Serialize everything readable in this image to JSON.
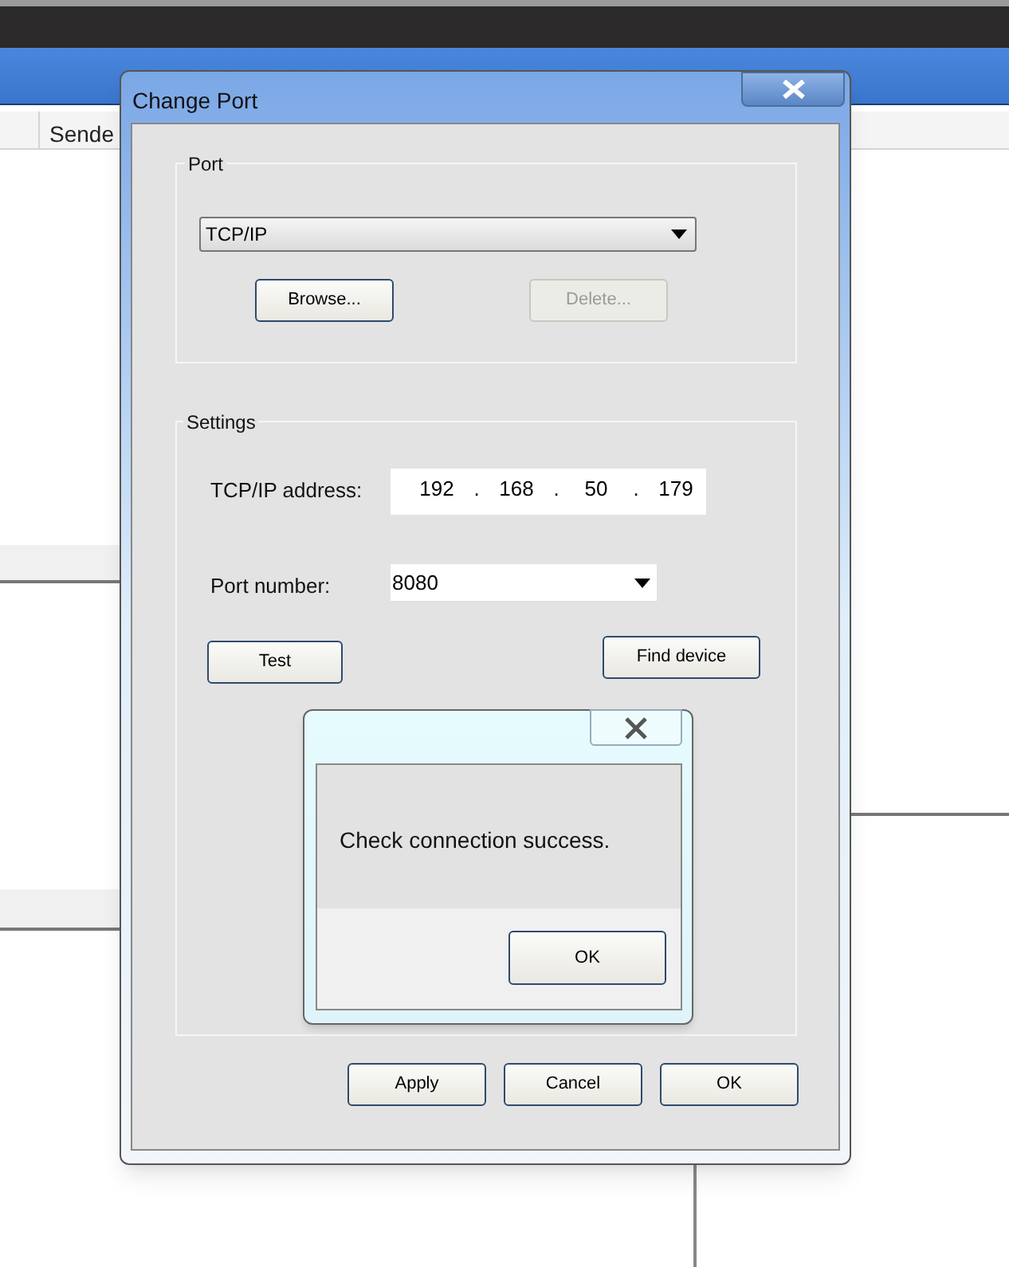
{
  "background_window": {
    "column_header": "Sende"
  },
  "dialog": {
    "title": "Change Port",
    "port_group": {
      "label": "Port",
      "port_type": "TCP/IP",
      "buttons": [
        {
          "label": "Browse...",
          "disabled": false
        },
        {
          "label": "Delete...",
          "disabled": true
        }
      ]
    },
    "settings_group": {
      "label": "Settings",
      "address_label": "TCP/IP address:",
      "address_octets": [
        "192",
        "168",
        "50",
        "179"
      ],
      "address_separator": ".",
      "port_label": "Port number:",
      "port_value": "8080",
      "test_button": "Test",
      "find_button": "Find device"
    },
    "buttons": [
      "Apply",
      "Cancel",
      "OK"
    ]
  },
  "message_box": {
    "text": "Check connection success.",
    "button": "OK"
  }
}
